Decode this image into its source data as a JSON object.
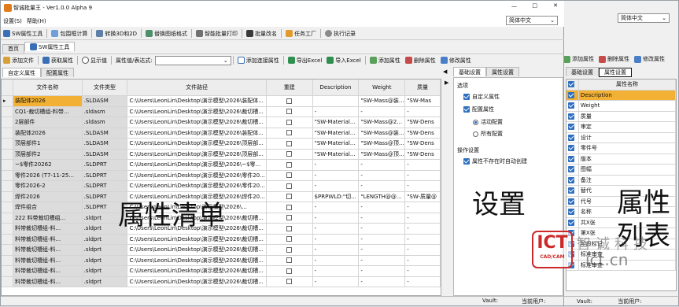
{
  "back_window": {
    "language_value": "简体中文",
    "toolbar": [
      "添加属性",
      "删除属性",
      "修改属性"
    ],
    "tabs": [
      "基础设置",
      "属性设置"
    ],
    "header": "属性名称",
    "rows": [
      "Description",
      "Weight",
      "质量",
      "审定",
      "设计",
      "零件号",
      "版本",
      "图幅",
      "备注",
      "替代",
      "代号",
      "名称",
      "共X张",
      "第X张",
      "阶段标记",
      "标准审查",
      "标准审查"
    ],
    "status_vault": "Vault:",
    "status_user": "当前用户:"
  },
  "app": {
    "title": "智诚批量王 - Ver1.0.0 Alpha 9",
    "menu": [
      "设置(S)",
      "帮助(H)"
    ],
    "language_value": "简体中文",
    "toolbar": [
      "SW属性工具",
      "包围框计算",
      "转换3D和2D",
      "替换图纸格式",
      "智能批量打印",
      "批量改名",
      "任务工厂",
      "执行记录"
    ],
    "doc_tabs": [
      "首页",
      "SW属性工具"
    ],
    "prop_toolbar": {
      "add_file": "添加文件",
      "get_props": "获取属性",
      "show_value": "显示值",
      "expr_label": "属性值/表达式:",
      "add_link": "添加连接属性",
      "export_excel": "导出Excel",
      "import_excel": "导入Excel",
      "add_prop": "添加属性",
      "del_prop": "删除属性",
      "edit_prop": "修改属性"
    },
    "sub_tabs": [
      "自定义属性",
      "配置属性"
    ],
    "columns": [
      "文件名称",
      "文件类型",
      "文件路径",
      "重建",
      "Description",
      "Weight",
      "质量"
    ],
    "rows": [
      [
        "装配体2026",
        ".SLDASM",
        "C:\\Users\\LeonLin\\Desktop\\演示模型\\2026\\装配体...",
        "",
        "\"SW-Mass@装...",
        "\"SW-Mas"
      ],
      [
        "CQ1-裁切槽组-料带...",
        ".sldasm",
        "C:\\Users\\LeonLin\\Desktop\\演示模型\\2026\\裁切槽...",
        "-",
        "-",
        "-"
      ],
      [
        "2层部件",
        ".sldasm",
        "C:\\Users\\LeonLin\\Desktop\\演示模型\\2026\\裁切槽...",
        "\"SW-Material...",
        "\"SW-Mass@2...",
        "\"SW-Dens"
      ],
      [
        "装配体2026",
        ".SLDASM",
        "C:\\Users\\LeonLin\\Desktop\\演示模型\\2026\\装配体...",
        "\"SW-Material...",
        "\"SW-Mass@装...",
        "\"SW-Dens"
      ],
      [
        "顶层部件1",
        ".SLDASM",
        "C:\\Users\\LeonLin\\Desktop\\演示模型\\2026\\顶层部...",
        "\"SW-Material...",
        "\"SW-Mass@顶...",
        "\"SW-Dens"
      ],
      [
        "顶层部件2",
        ".SLDASM",
        "C:\\Users\\LeonLin\\Desktop\\演示模型\\2026\\顶层部...",
        "\"SW-Material...",
        "\"SW-Mass@顶...",
        "\"SW-Dens"
      ],
      [
        "~$零件20262",
        ".SLDPRT",
        "C:\\Users\\LeonLin\\Desktop\\演示模型\\2026\\~$零...",
        "-",
        "-",
        "-"
      ],
      [
        "零件2026 (T7-11-25...",
        ".SLDPRT",
        "C:\\Users\\LeonLin\\Desktop\\演示模型\\2026\\零件20...",
        "-",
        "-",
        "-"
      ],
      [
        "零件2026-2",
        ".SLDPRT",
        "C:\\Users\\LeonLin\\Desktop\\演示模型\\2026\\零件20...",
        "-",
        "-",
        "-"
      ],
      [
        "焊件2026",
        ".SLDPRT",
        "C:\\Users\\LeonLin\\Desktop\\演示模型\\2026\\焊件20...",
        "$PRPWLD:\"切...",
        "\"LENGTH@@...",
        "\"SW-质量@"
      ],
      [
        "焊件组合",
        ".SLDPRT",
        "C:\\Users\\LeonLin\\Desktop\\演示模型\\2026\\...",
        "-",
        "-",
        "-"
      ],
      [
        "222 料带裁切槽组...",
        ".sldprt",
        "C:\\Users\\LeonLin\\Desktop\\演示模型\\2026\\裁切槽...",
        "-",
        "-",
        "-"
      ],
      [
        "料带裁切槽组-料...",
        ".sldprt",
        "C:\\Users\\LeonLin\\Desktop\\演示模型\\2026\\裁切槽...",
        "-",
        "-",
        "-"
      ],
      [
        "料带裁切槽组-料...",
        ".sldprt",
        "C:\\Users\\LeonLin\\Desktop\\演示模型\\2026\\裁切槽...",
        "-",
        "-",
        "-"
      ],
      [
        "料带裁切槽组-料...",
        ".sldprt",
        "C:\\Users\\LeonLin\\Desktop\\演示模型\\2026\\裁切槽...",
        "-",
        "-",
        "-"
      ],
      [
        "料带裁切槽组-料...",
        ".sldprt",
        "C:\\Users\\LeonLin\\Desktop\\演示模型\\2026\\裁切槽...",
        "-",
        "-",
        "-"
      ],
      [
        "料带裁切槽组-料...",
        ".sldprt",
        "C:\\Users\\LeonLin\\Desktop\\演示模型\\2026\\裁切槽...",
        "-",
        "-",
        "-"
      ],
      [
        "料带裁切槽组-料...",
        ".sldprt",
        "C:\\Users\\LeonLin\\Desktop\\演示模型\\2026\\裁切槽...",
        "-",
        "-",
        "-"
      ]
    ],
    "settings": {
      "tabs": [
        "基础设置",
        "属性设置"
      ],
      "group1": "选项",
      "opt_custom": "自定义属性",
      "opt_config": "配置属性",
      "radio_active": "活动配置",
      "radio_all": "所有配置",
      "group2": "操作设置",
      "opt_autocreate": "属性不存在时自动创建"
    },
    "status_vault": "Vault:",
    "status_user": "当前用户:"
  },
  "overlays": {
    "list_label": "属性清单",
    "settings_label": "设置",
    "proplist_label": [
      "属性",
      "列表"
    ],
    "watermark_logo": "ICT",
    "watermark_sub": "CAD/CAM",
    "watermark_text": "智诚科技",
    "watermark_url": "ict.cn"
  },
  "colors": {
    "accent": "#2f6fc0",
    "selected_cell": "#f2b134",
    "watermark": "#cc2a2a"
  }
}
